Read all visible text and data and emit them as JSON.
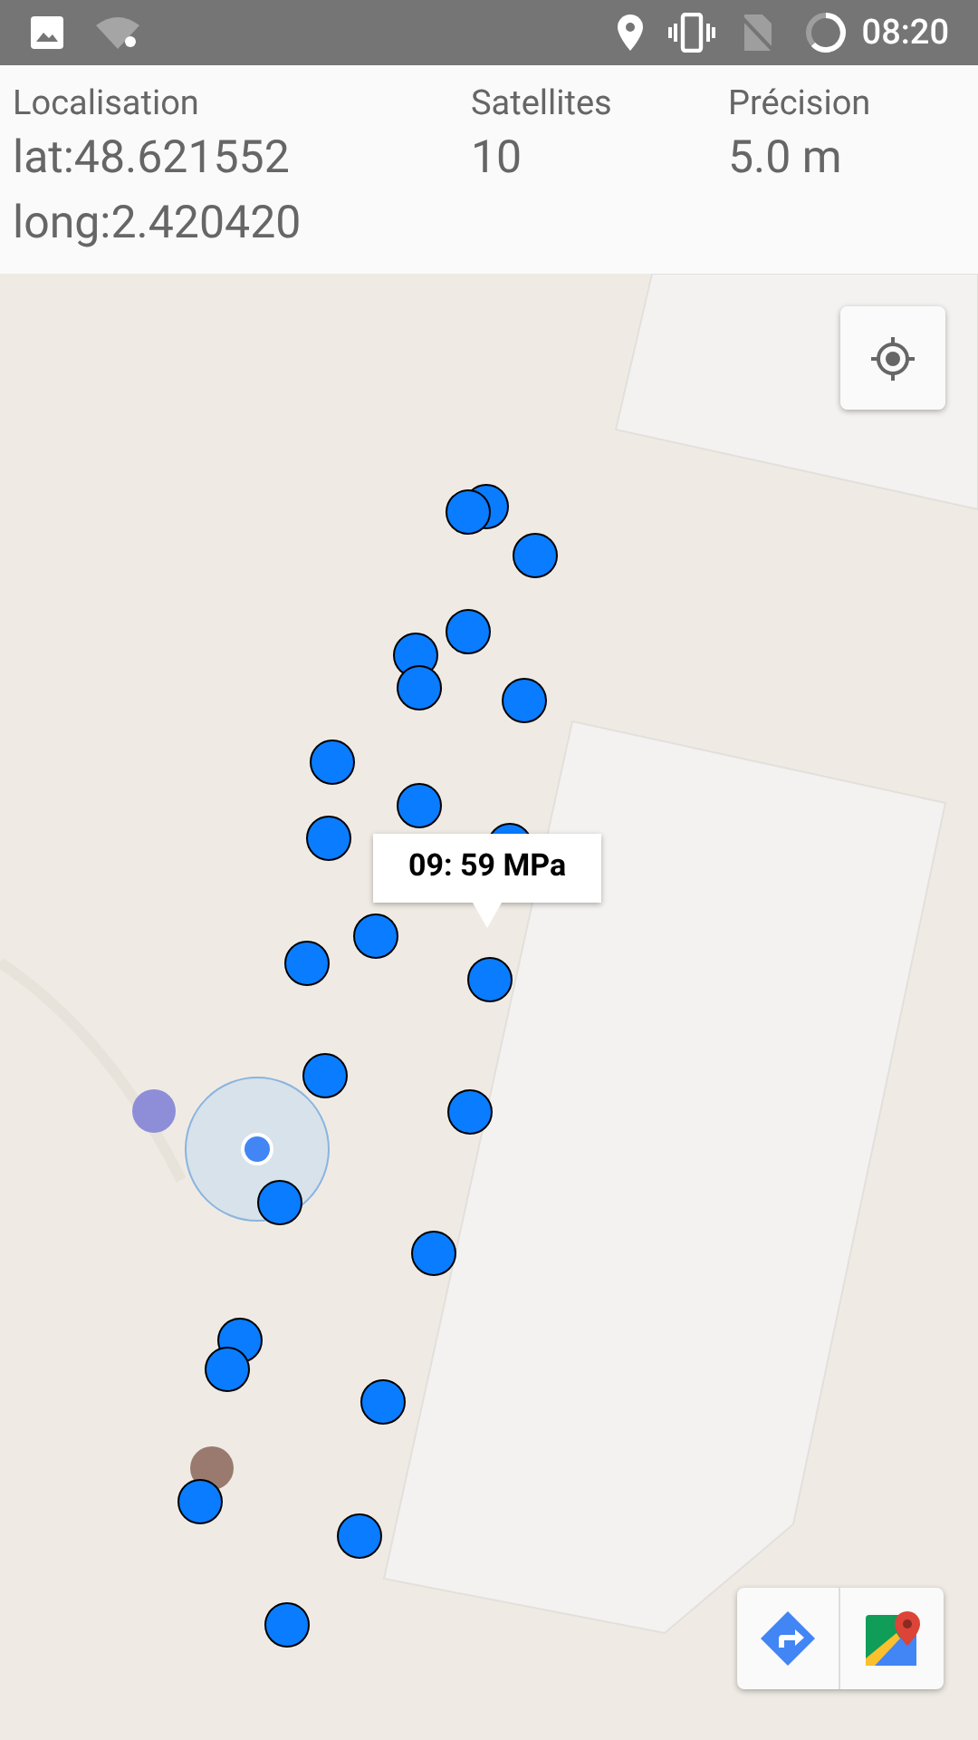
{
  "status_bar": {
    "time": "08:20"
  },
  "header": {
    "columns": [
      {
        "label": "Localisation",
        "values": [
          "lat:48.621552",
          "long:2.420420"
        ]
      },
      {
        "label": "Satellites",
        "values": [
          "10"
        ]
      },
      {
        "label": "Précision",
        "values": [
          "5.0 m"
        ]
      }
    ]
  },
  "map": {
    "info_window": "09: 59 MPa"
  }
}
